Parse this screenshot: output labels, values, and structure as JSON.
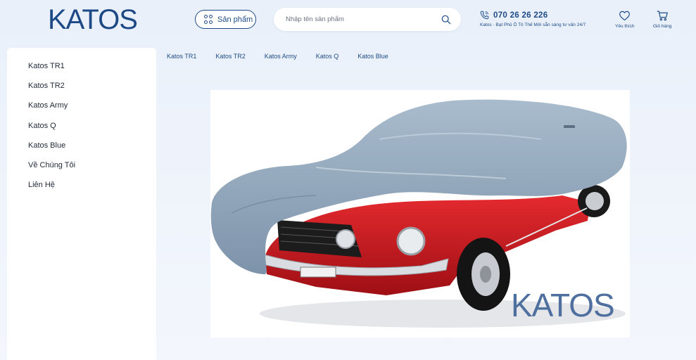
{
  "header": {
    "logo": "KATOS",
    "products_button": "Sản phẩm",
    "search_placeholder": "Nhập tên sản phẩm",
    "phone": "070 26 26 226",
    "tagline": "Katos · Bạt Phủ Ô Tô Thế Mới sẵn sàng tư vấn 24/7",
    "wishlist_label": "Yêu thích",
    "cart_label": "Giỏ hàng"
  },
  "sidebar": {
    "items": [
      {
        "label": "Katos TR1"
      },
      {
        "label": "Katos TR2"
      },
      {
        "label": "Katos Army"
      },
      {
        "label": "Katos Q"
      },
      {
        "label": "Katos Blue"
      },
      {
        "label": "Về Chúng Tôi"
      },
      {
        "label": "Liên Hệ"
      }
    ]
  },
  "topnav": {
    "items": [
      {
        "label": "Katos TR1"
      },
      {
        "label": "Katos TR2"
      },
      {
        "label": "Katos Army"
      },
      {
        "label": "Katos Q"
      },
      {
        "label": "Katos Blue"
      }
    ]
  },
  "banner": {
    "logo": "KATOS"
  },
  "colors": {
    "brand": "#1d4a86",
    "cover": "#8fa3b8",
    "car_body": "#d0141c"
  }
}
